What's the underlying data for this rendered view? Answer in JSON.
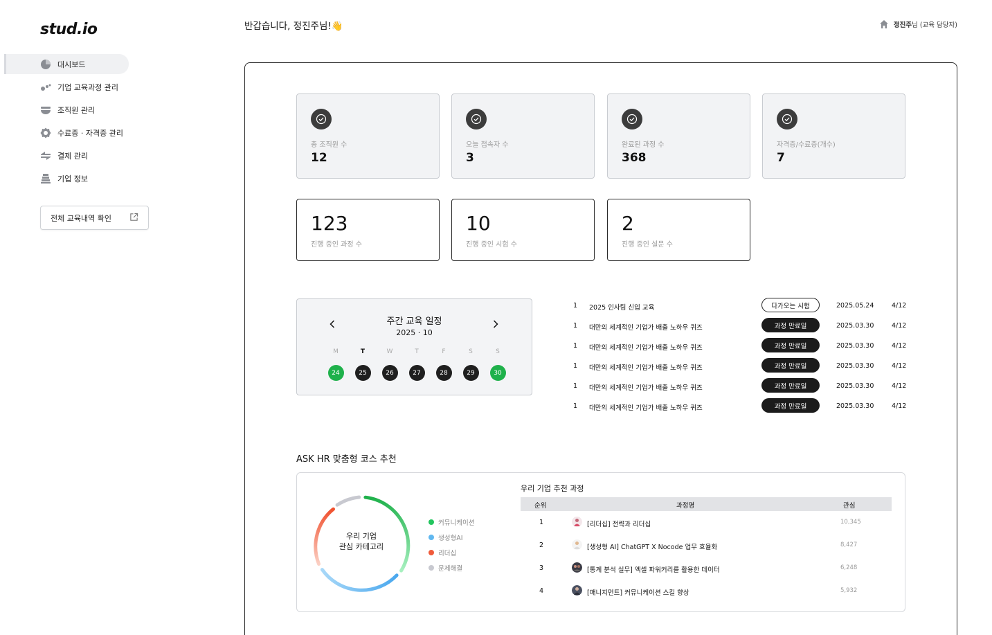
{
  "app": {
    "logo": "stud.io"
  },
  "header": {
    "greeting": "반갑습니다, 정진주님!👋",
    "user_name": "정진주",
    "user_suffix": "님 (교육 담당자)"
  },
  "sidebar": {
    "items": [
      {
        "label": "대시보드",
        "icon": "pie-chart-icon",
        "active": true
      },
      {
        "label": "기업 교육과정 관리",
        "icon": "dots-cluster-icon",
        "active": false
      },
      {
        "label": "조직원 관리",
        "icon": "bowl-stack-icon",
        "active": false
      },
      {
        "label": "수료증 · 자격증 관리",
        "icon": "gear-badge-icon",
        "active": false
      },
      {
        "label": "결제 관리",
        "icon": "exchange-arrows-icon",
        "active": false
      },
      {
        "label": "기업 정보",
        "icon": "building-icon",
        "active": false
      }
    ],
    "history_button": "전체 교육내역 확인"
  },
  "stats": [
    {
      "label": "총 조직원 수",
      "value": "12"
    },
    {
      "label": "오늘 접속자 수",
      "value": "3"
    },
    {
      "label": "완료된 과정 수",
      "value": "368"
    },
    {
      "label": "자격증/수료증(개수)",
      "value": "7"
    }
  ],
  "ongoing": [
    {
      "value": "123",
      "label": "진행 중인 과정 수"
    },
    {
      "value": "10",
      "label": "진행 중인 시험 수"
    },
    {
      "value": "2",
      "label": "진행 중인 설문 수"
    }
  ],
  "calendar": {
    "title": "주간 교육 일정",
    "month": "2025 · 10",
    "weekdays": [
      "M",
      "T",
      "W",
      "T",
      "F",
      "S",
      "S"
    ],
    "dates": [
      "24",
      "25",
      "26",
      "27",
      "28",
      "29",
      "30"
    ],
    "highlight_color": "#1fb14b"
  },
  "exams": [
    {
      "idx": "1",
      "title": "2025 인사팀 신입 교육",
      "status": "다가오는 시험",
      "date": "2025.05.24",
      "count": "4/12"
    },
    {
      "idx": "1",
      "title": "대만의 세계적인 기업가 배출 노하우 퀴즈",
      "status": "과정 만료일",
      "date": "2025.03.30",
      "count": "4/12"
    },
    {
      "idx": "1",
      "title": "대만의 세계적인 기업가 배출 노하우 퀴즈",
      "status": "과정 만료일",
      "date": "2025.03.30",
      "count": "4/12"
    },
    {
      "idx": "1",
      "title": "대만의 세계적인 기업가 배출 노하우 퀴즈",
      "status": "과정 만료일",
      "date": "2025.03.30",
      "count": "4/12"
    },
    {
      "idx": "1",
      "title": "대만의 세계적인 기업가 배출 노하우 퀴즈",
      "status": "과정 만료일",
      "date": "2025.03.30",
      "count": "4/12"
    },
    {
      "idx": "1",
      "title": "대만의 세계적인 기업가 배출 노하우 퀴즈",
      "status": "과정 만료일",
      "date": "2025.03.30",
      "count": "4/12"
    }
  ],
  "askhr": {
    "title": "ASK HR 맞춤형 코스 추천",
    "donut_label_line1": "우리 기업",
    "donut_label_line2": "관심 카테고리",
    "legend": [
      {
        "label": "커뮤니케이션",
        "color": "#22c55e"
      },
      {
        "label": "생성형AI",
        "color": "#60b8f0"
      },
      {
        "label": "리더십",
        "color": "#f05a3a"
      },
      {
        "label": "문제해결",
        "color": "#c8c9d0"
      }
    ],
    "rec_title": "우리 기업 추천 과정",
    "columns": {
      "rank": "순위",
      "course": "과정명",
      "interest": "관심"
    },
    "rows": [
      {
        "rank": "1",
        "course": "[리더십] 전략과 리더십",
        "interest": "10,345"
      },
      {
        "rank": "2",
        "course": "[생성형 AI] ChatGPT X Nocode 업무 효율화",
        "interest": "8,427"
      },
      {
        "rank": "3",
        "course": "[통계 분석 실무] 엑셀 파워커리를 활용한 데이터",
        "interest": "6,248"
      },
      {
        "rank": "4",
        "course": "[매니지먼트] 커뮤니케이션 스킬 향상",
        "interest": "5,932"
      }
    ]
  }
}
